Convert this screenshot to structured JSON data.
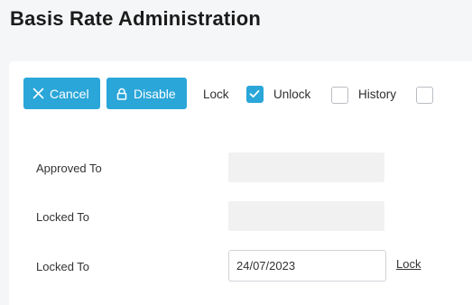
{
  "page": {
    "title": "Basis Rate Administration"
  },
  "toolbar": {
    "cancel_label": "Cancel",
    "disable_label": "Disable",
    "lock_label": "Lock",
    "unlock_label": "Unlock",
    "history_label": "History",
    "lock_checked": true,
    "unlock_checked": false,
    "history_checked": false
  },
  "form": {
    "approved_to_label": "Approved To",
    "approved_to_value": "",
    "locked_to_label_1": "Locked To",
    "locked_to_value_1": "",
    "locked_to_label_2": "Locked To",
    "locked_to_value_2": "24/07/2023",
    "lock_link": "Lock"
  },
  "colors": {
    "accent": "#2aa6d9",
    "background": "#f4f6f8",
    "card": "#ffffff",
    "disabled_field": "#f1f1f1"
  },
  "icons": {
    "cancel": "close-icon",
    "disable": "lock-icon",
    "checked": "checkmark-icon"
  }
}
